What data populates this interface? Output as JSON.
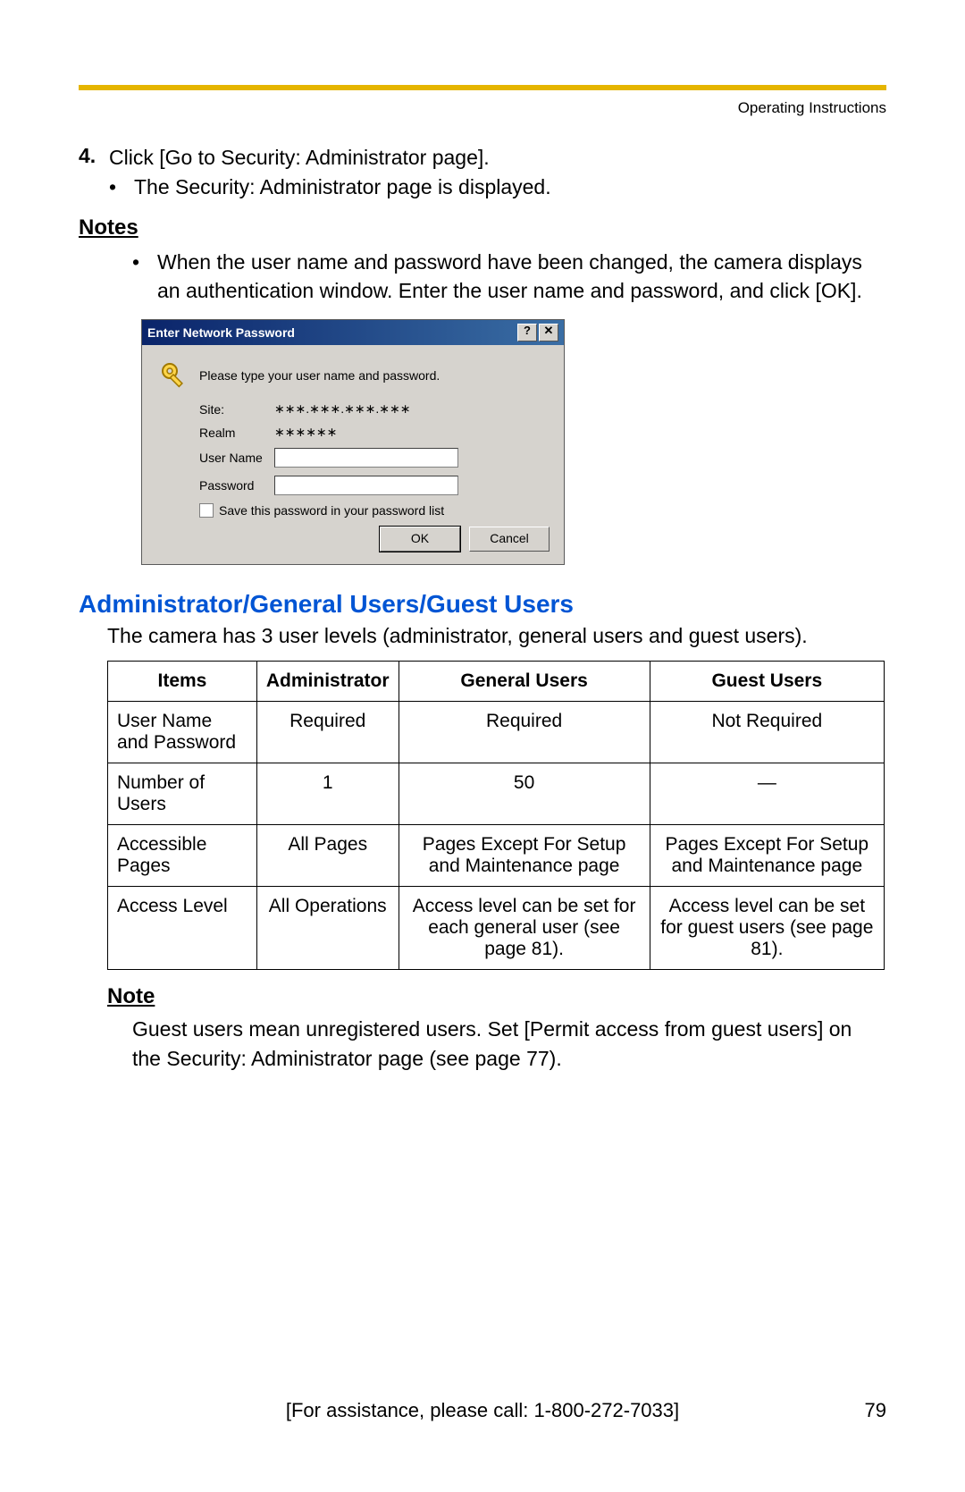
{
  "header": {
    "label": "Operating Instructions"
  },
  "step": {
    "number": "4.",
    "text": "Click [Go to Security: Administrator page].",
    "sub": "The Security: Administrator page is displayed."
  },
  "notes1": {
    "heading": "Notes",
    "text": "When the user name and password have been changed, the camera displays an authentication window. Enter the user name and password, and click [OK]."
  },
  "dialog": {
    "title": "Enter Network Password",
    "help_btn": "?",
    "close_btn": "✕",
    "prompt": "Please type your user name and password.",
    "labels": {
      "site": "Site:",
      "realm": "Realm",
      "user": "User Name",
      "pass": "Password"
    },
    "site_value": "∗∗∗.∗∗∗.∗∗∗.∗∗∗",
    "realm_value": "∗∗∗∗∗∗",
    "checkbox": "Save this password in your password list",
    "ok": "OK",
    "cancel": "Cancel"
  },
  "section": {
    "heading": "Administrator/General Users/Guest Users",
    "intro": "The camera has 3 user levels (administrator, general users and guest users)."
  },
  "table": {
    "headers": [
      "Items",
      "Administrator",
      "General Users",
      "Guest Users"
    ],
    "rows": [
      [
        "User Name and Password",
        "Required",
        "Required",
        "Not Required"
      ],
      [
        "Number of Users",
        "1",
        "50",
        "—"
      ],
      [
        "Accessible Pages",
        "All Pages",
        "Pages Except For Setup and Maintenance page",
        "Pages Except For Setup and Maintenance page"
      ],
      [
        "Access Level",
        "All Operations",
        "Access level can be set for each general user (see page 81).",
        "Access level can be set for guest users (see page 81)."
      ]
    ]
  },
  "note2": {
    "heading": "Note",
    "text": "Guest users mean unregistered users. Set [Permit access from guest users] on the Security: Administrator page (see page 77)."
  },
  "footer": {
    "assist": "[For assistance, please call: 1-800-272-7033]",
    "page": "79"
  }
}
